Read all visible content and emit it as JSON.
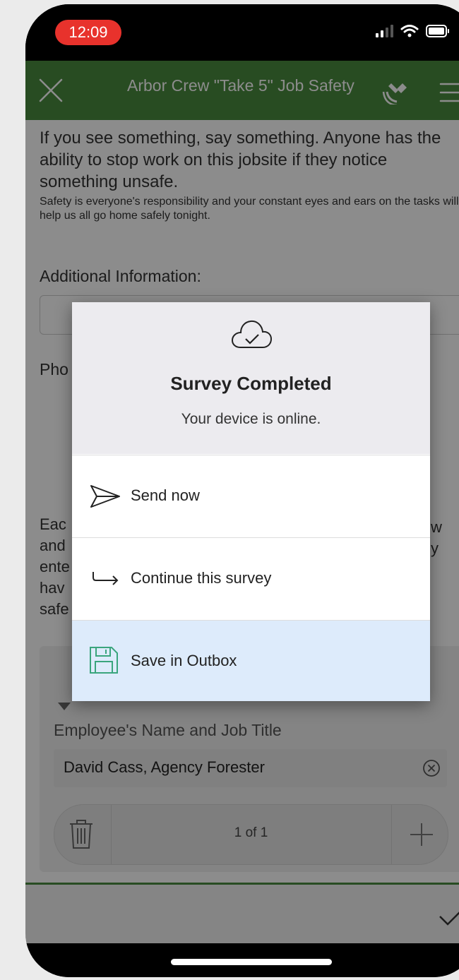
{
  "status_bar": {
    "time": "12:09"
  },
  "header": {
    "title": "Arbor Crew \"Take 5\" Job Safety"
  },
  "form": {
    "intro_heading": "If you see something, say something. Anyone has the ability to stop work on this jobsite if they notice something unsafe.",
    "intro_note": "Safety is everyone's responsibility and your constant eyes and ears on the tasks will help us all go home safely tonight.",
    "additional_label": "Additional Information:",
    "photo_label_visible": "Pho",
    "each_text_visible": "Eac\nand\nente\nhav\nsafe",
    "each_text_right": "w\ny",
    "employee_label": "Employee's Name and Job Title",
    "employee_value": "David Cass, Agency Forester",
    "pager_text": "1 of 1"
  },
  "dialog": {
    "title": "Survey Completed",
    "subtitle": "Your device is online.",
    "options": [
      {
        "label": "Send now",
        "icon": "send-icon"
      },
      {
        "label": "Continue this survey",
        "icon": "continue-arrow-icon"
      },
      {
        "label": "Save in Outbox",
        "icon": "save-icon",
        "highlighted": true
      }
    ]
  },
  "colors": {
    "header_green": "#4a8a3e",
    "time_pill_red": "#e8322c",
    "highlight_blue": "#ddebfb",
    "save_icon_green": "#3aa57d"
  }
}
